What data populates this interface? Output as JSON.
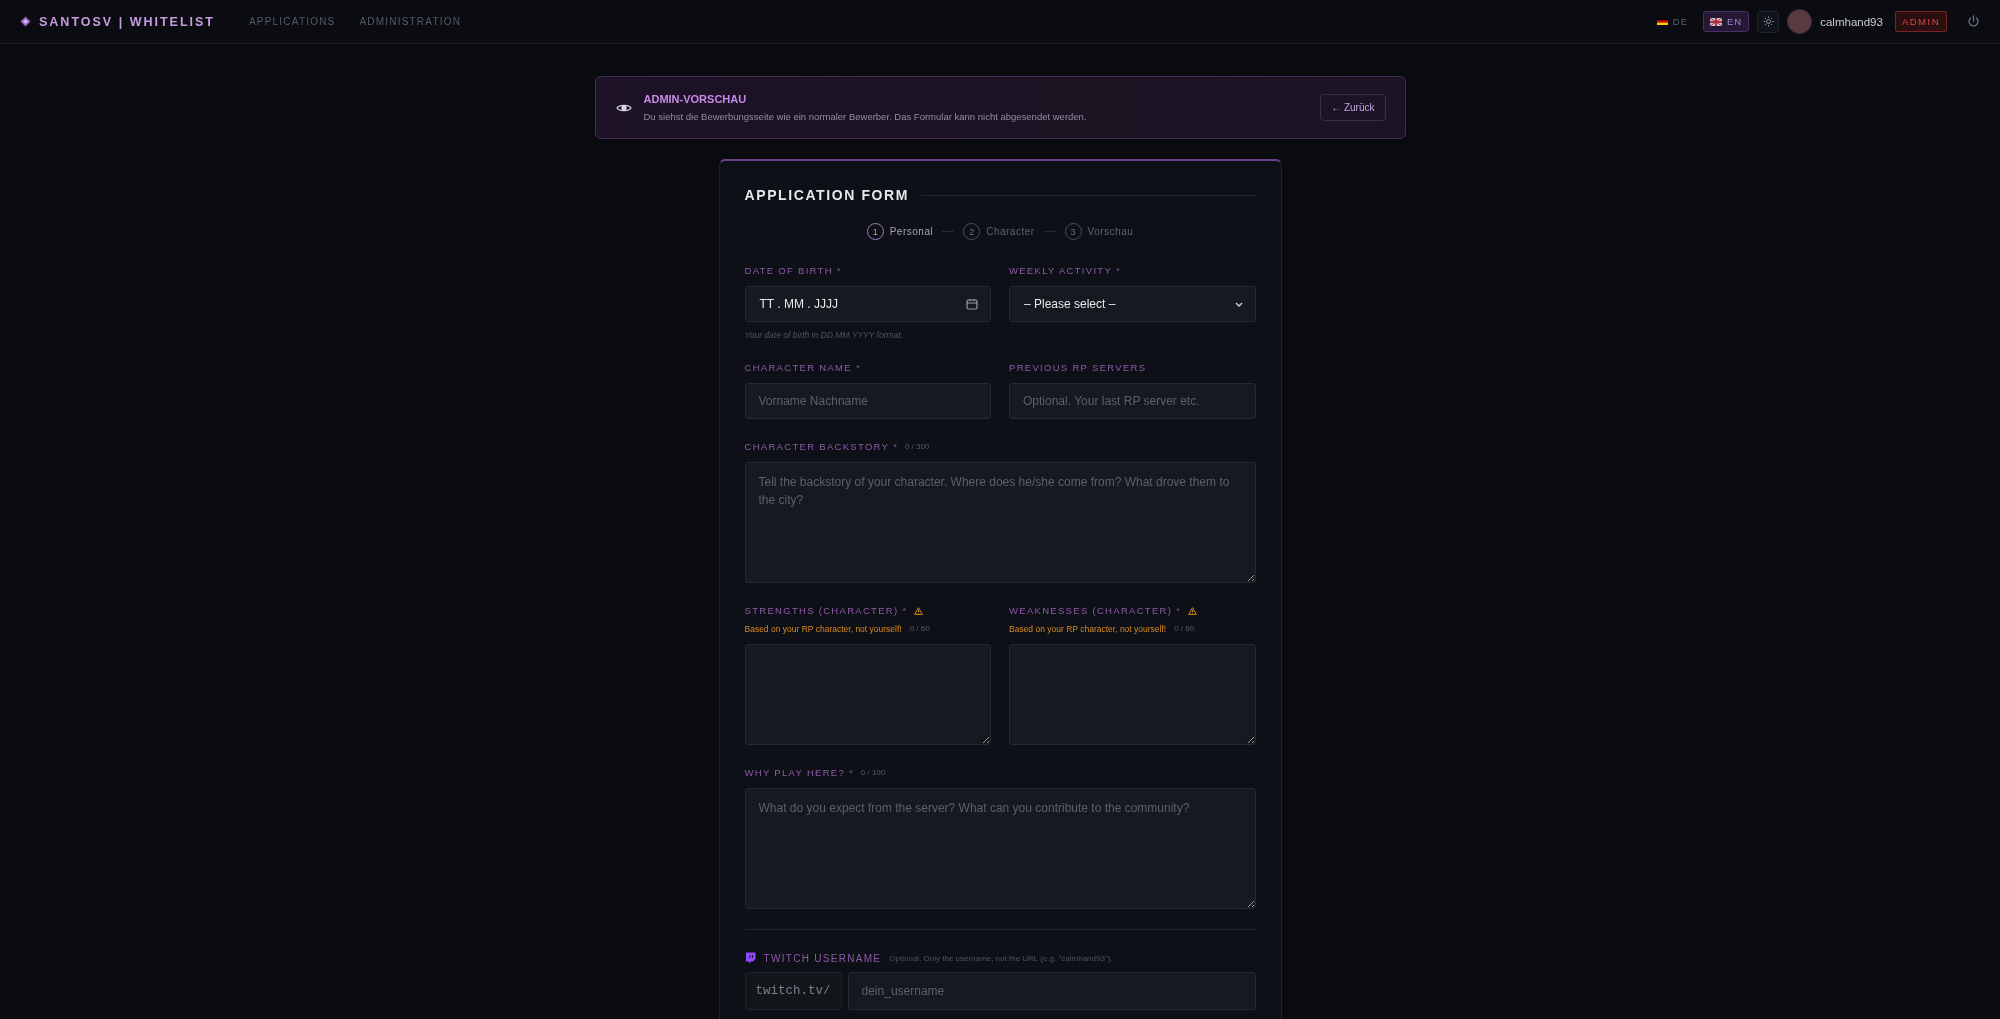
{
  "topbar": {
    "brand": "SANTOSV | WHITELIST",
    "links": [
      {
        "label": "APPLICATIONS",
        "selected": false
      },
      {
        "label": "ADMINISTRATION",
        "selected": false
      }
    ],
    "languages": [
      {
        "code": "DE",
        "kind": "de",
        "selected": false
      },
      {
        "code": "EN",
        "kind": "gb",
        "selected": true
      }
    ],
    "user": {
      "name": "calmhand93",
      "role": "ADMIN"
    }
  },
  "banner": {
    "title": "ADMIN-VORSCHAU",
    "text": "Du siehst die Bewerbungsseite wie ein normaler Bewerber. Das Formular kann nicht abgesendet werden.",
    "button": "← Zurück"
  },
  "form": {
    "title": "APPLICATION FORM",
    "steps": [
      {
        "number": "1",
        "label": "Personal",
        "selected": true
      },
      {
        "number": "2",
        "label": "Character",
        "selected": false
      },
      {
        "number": "3",
        "label": "Vorschau",
        "selected": false
      }
    ],
    "fields": [
      {
        "kind": "date",
        "label": "DATE OF BIRTH",
        "required_mark": "*",
        "value": "TT . MM . JJJJ",
        "hint": "Your date of birth in DD.MM.YYYY format."
      },
      {
        "kind": "select",
        "label": "WEEKLY ACTIVITY",
        "required_mark": "*",
        "value": "– Please select –"
      },
      {
        "kind": "text",
        "label": "CHARACTER NAME",
        "required_mark": "*",
        "placeholder": "Vorname Nachname"
      },
      {
        "kind": "text",
        "label": "PREVIOUS RP SERVERS",
        "placeholder": "Optional. Your last RP server etc."
      },
      {
        "kind": "textarea",
        "wide": true,
        "label": "CHARACTER BACKSTORY",
        "required_mark": "*",
        "counter": "0 / 300",
        "placeholder": "Tell the backstory of your character. Where does he/she come from? What drove them to the city?"
      },
      {
        "kind": "textarea",
        "label": "STRENGTHS (CHARACTER)",
        "required_mark": "*",
        "warning": "Based on your RP character, not yourself!",
        "counter": "0 / 60"
      },
      {
        "kind": "textarea",
        "label": "WEAKNESSES (CHARACTER)",
        "required_mark": "*",
        "warning": "Based on your RP character, not yourself!",
        "counter": "0 / 60"
      },
      {
        "kind": "textarea",
        "wide": true,
        "label": "WHY PLAY HERE?",
        "required_mark": "*",
        "counter": "0 / 100",
        "placeholder": "What do you expect from the server? What can you contribute to the community?"
      }
    ],
    "twitch": {
      "label": "TWITCH USERNAME",
      "note": "Optional. Only the username, not the URL (e.g. \"calmhand93\").",
      "prefix": "twitch.tv/",
      "placeholder": "dein_username"
    }
  }
}
